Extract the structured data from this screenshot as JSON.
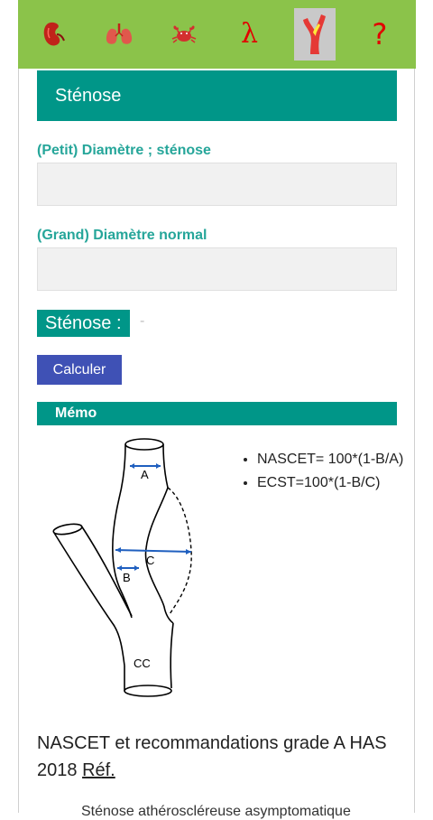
{
  "toolbar": {
    "items": [
      {
        "icon": "kidney-icon"
      },
      {
        "icon": "lungs-icon"
      },
      {
        "icon": "crab-icon"
      },
      {
        "icon": "lambda-icon",
        "text": "λ"
      },
      {
        "icon": "artery-icon",
        "active": true
      },
      {
        "icon": "help-icon",
        "text": "?"
      }
    ],
    "accent": "#8bc34a",
    "icon_color": "#e10000"
  },
  "header": {
    "title": "Sténose",
    "color": "#009688"
  },
  "form": {
    "small_diameter_label": "(Petit) Diamètre ; sténose",
    "small_diameter_value": "",
    "large_diameter_label": "(Grand) Diamètre normal",
    "large_diameter_value": ""
  },
  "result": {
    "label": "Sténose :",
    "value": "-"
  },
  "calculate_button": {
    "label": "Calculer",
    "color": "#3f51b5"
  },
  "memo": {
    "title": "Mémo",
    "diagram_labels": {
      "a": "A",
      "b": "B",
      "c": "C",
      "cc": "CC"
    },
    "formulas": [
      "NASCET= 100*(1-B/A)",
      "ECST=100*(1-B/C)"
    ],
    "reference_text": "NASCET et recommandations grade A HAS 2018",
    "reference_link": "Réf.",
    "next_text": "Sténose athéroscléreuse asymptomatique"
  }
}
